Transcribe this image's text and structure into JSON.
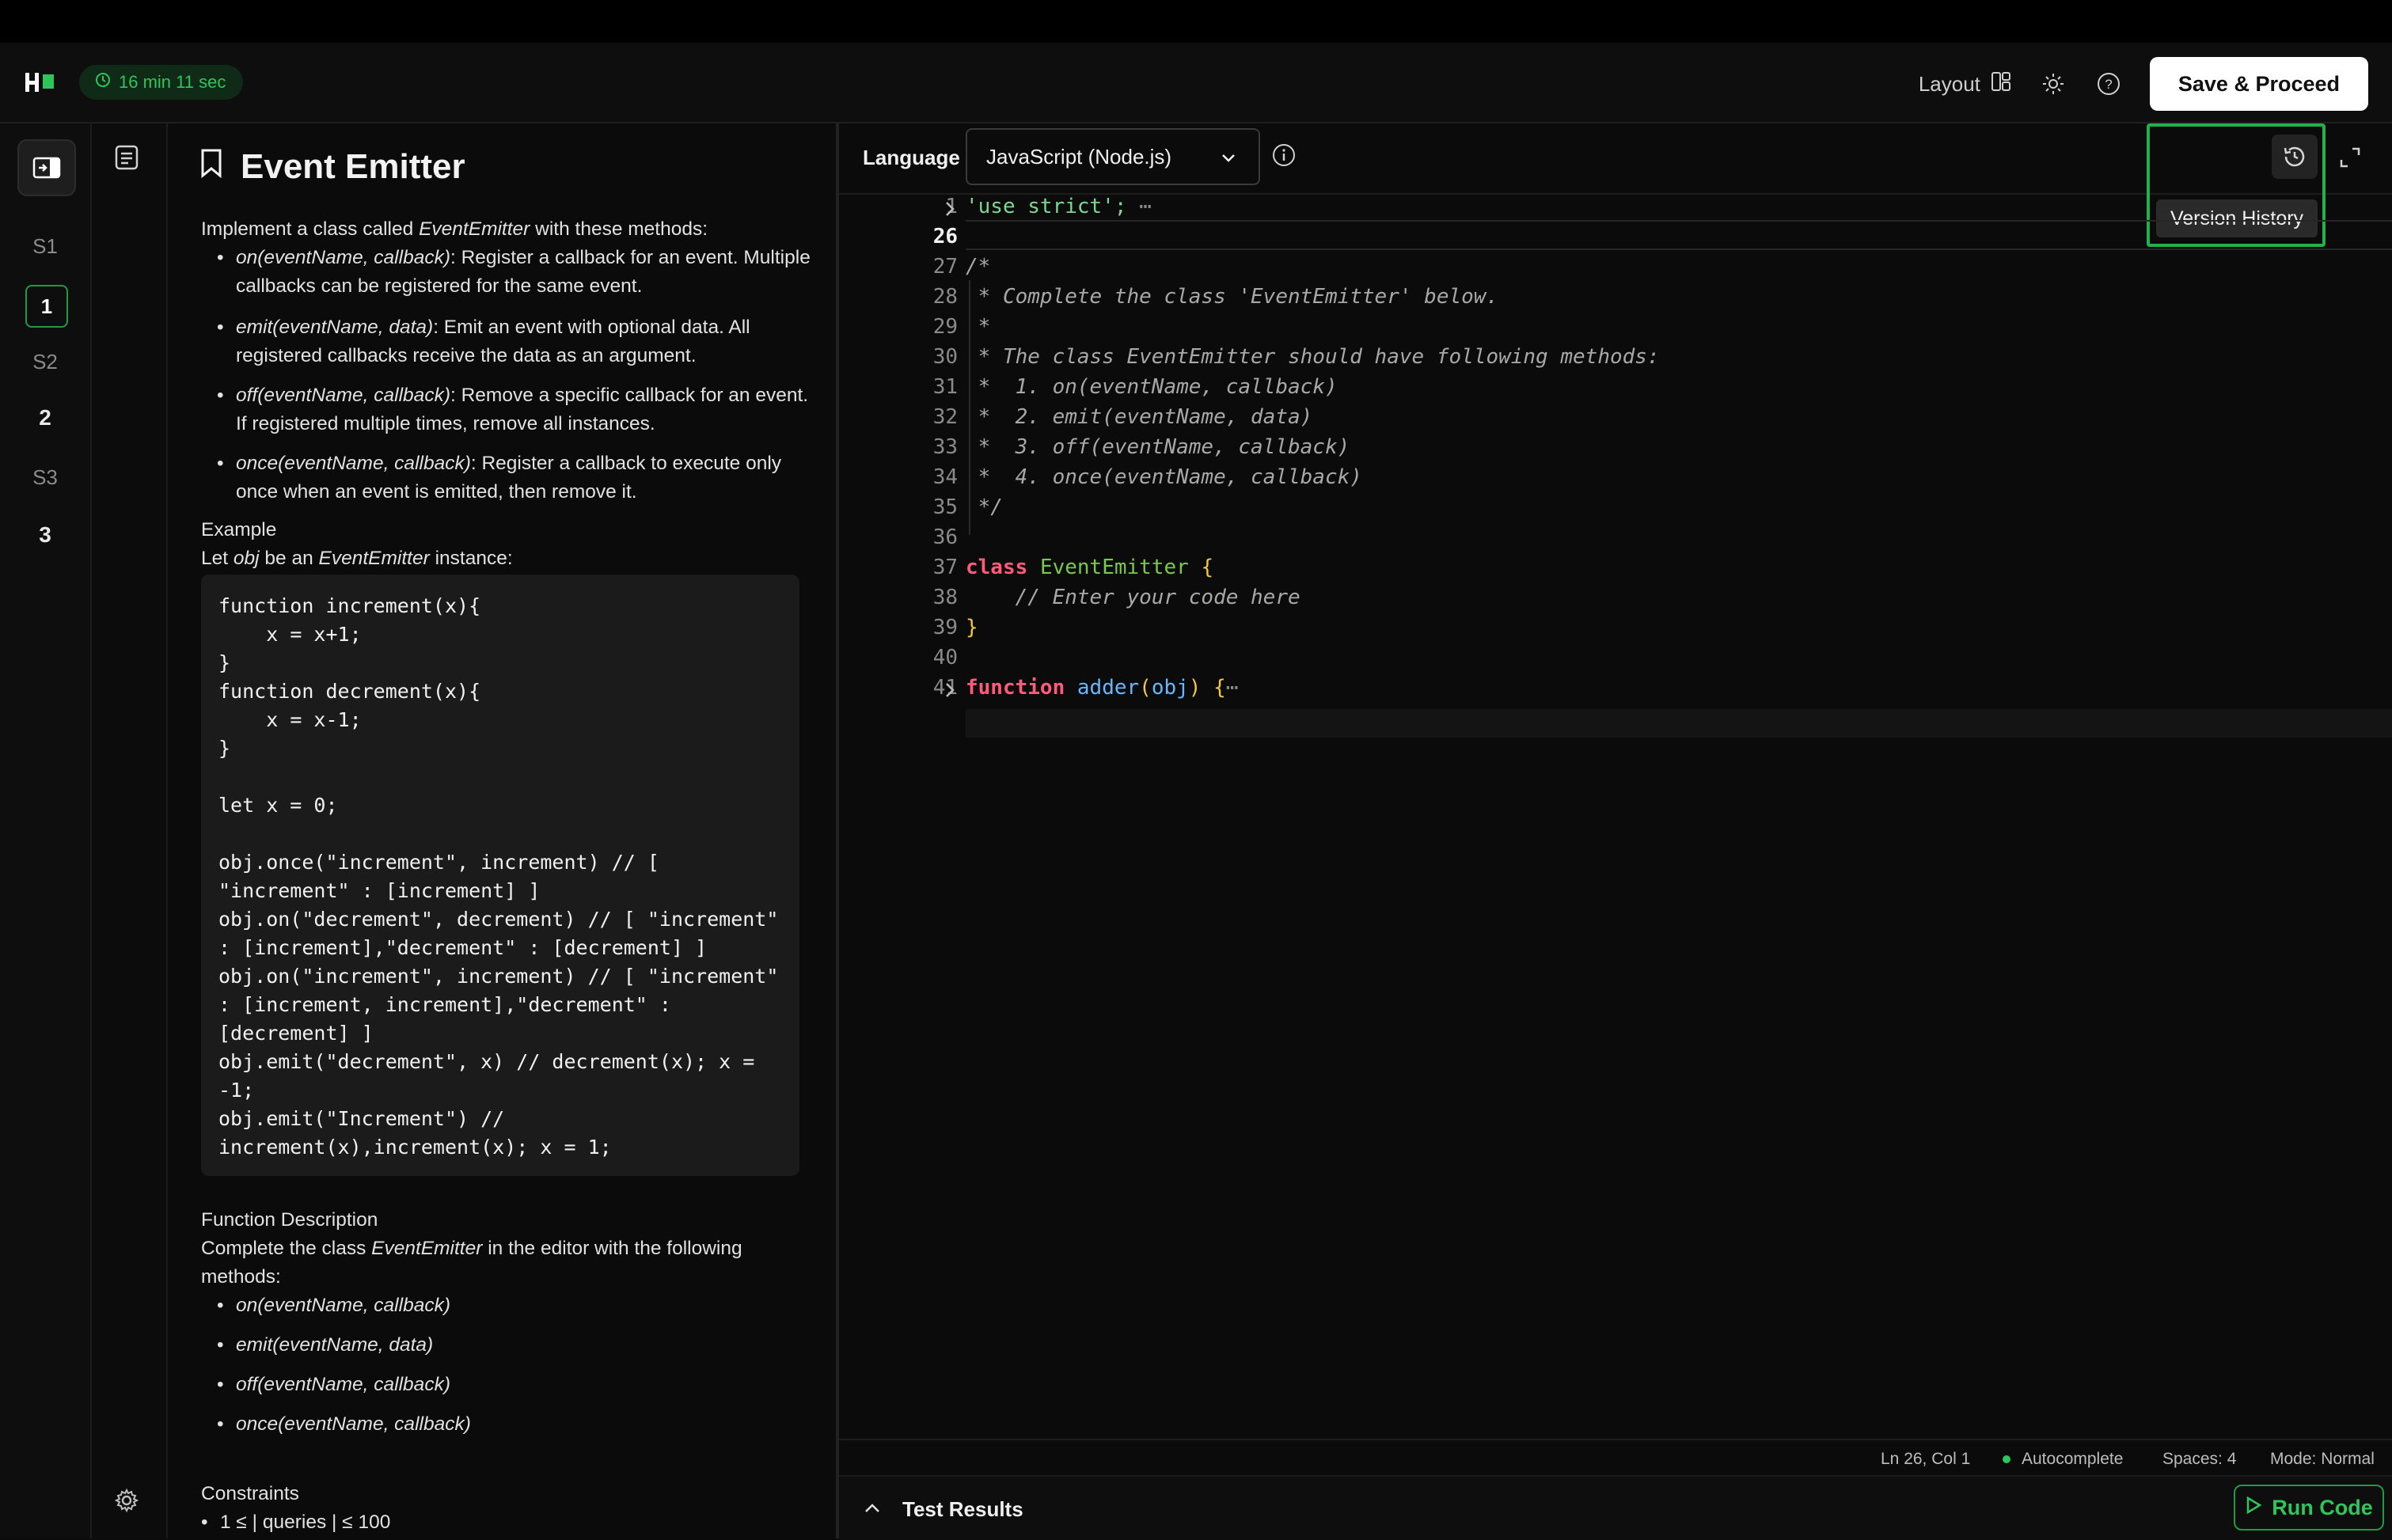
{
  "header": {
    "timer": "16 min 11 sec",
    "layout_label": "Layout",
    "save_label": "Save & Proceed"
  },
  "rail": {
    "sections": [
      "S1",
      "S2",
      "S3"
    ],
    "questions": [
      "1",
      "2",
      "3"
    ],
    "active_question": "1"
  },
  "problem": {
    "title": "Event Emitter",
    "intro": "Implement a class called EventEmitter with these methods:",
    "methods": [
      {
        "sig": "on(eventName, callback)",
        "desc": ": Register a callback for an event. Multiple callbacks can be registered for the same event."
      },
      {
        "sig": "emit(eventName, data)",
        "desc": ": Emit an event with optional data. All registered callbacks receive the data as an argument."
      },
      {
        "sig": "off(eventName, callback)",
        "desc": ": Remove a specific callback for an event. If registered multiple times, remove all instances."
      },
      {
        "sig": "once(eventName, callback)",
        "desc": ": Register a callback to execute only once when an event is emitted, then remove it."
      }
    ],
    "example_heading": "Example",
    "example_intro": "Let obj be an EventEmitter instance:",
    "example_code": "function increment(x){\n    x = x+1;\n}\nfunction decrement(x){\n    x = x-1;\n}\n\nlet x = 0;\n\nobj.once(\"increment\", increment) // [ \"increment\" : [increment] ]\nobj.on(\"decrement\", decrement) // [ \"increment\" : [increment],\"decrement\" : [decrement] ]\nobj.on(\"increment\", increment) // [ \"increment\" : [increment, increment],\"decrement\" : [decrement] ]\nobj.emit(\"decrement\", x) // decrement(x); x = -1;\nobj.emit(\"Increment\") // increment(x),increment(x); x = 1;",
    "func_desc_heading": "Function Description",
    "func_desc_text": "Complete the class EventEmitter in the editor with the following methods:",
    "func_list": [
      "on(eventName, callback)",
      "emit(eventName, data)",
      "off(eventName, callback)",
      "once(eventName, callback)"
    ],
    "constraints_heading": "Constraints",
    "constraint_1": "1 ≤ | queries | ≤ 100"
  },
  "editor": {
    "language_label": "Language",
    "language_value": "JavaScript (Node.js)",
    "version_history_tooltip": "Version History",
    "line_numbers": [
      "1",
      "26",
      "27",
      "28",
      "29",
      "30",
      "31",
      "32",
      "33",
      "34",
      "35",
      "36",
      "37",
      "38",
      "39",
      "40",
      "41"
    ],
    "code": {
      "l1": "'use strict';",
      "l27": "/*",
      "l28": " * Complete the class 'EventEmitter' below.",
      "l29": " *",
      "l30": " * The class EventEmitter should have following methods:",
      "l31": " *  1. on(eventName, callback)",
      "l32": " *  2. emit(eventName, data)",
      "l33": " *  3. off(eventName, callback)",
      "l34": " *  4. once(eventName, callback)",
      "l35": " */",
      "l37_kw": "class",
      "l37_name": "EventEmitter",
      "l38": "    // Enter your code here",
      "l41_kw": "function",
      "l41_name": "adder",
      "l41_param": "obj"
    },
    "status": {
      "position": "Ln 26, Col 1",
      "autocomplete": "Autocomplete",
      "spaces": "Spaces: 4",
      "mode": "Mode: Normal"
    },
    "test_results_label": "Test Results",
    "run_label": "Run Code"
  },
  "colors": {
    "accent_green": "#2fc55a",
    "highlight_box": "#22b14c"
  }
}
